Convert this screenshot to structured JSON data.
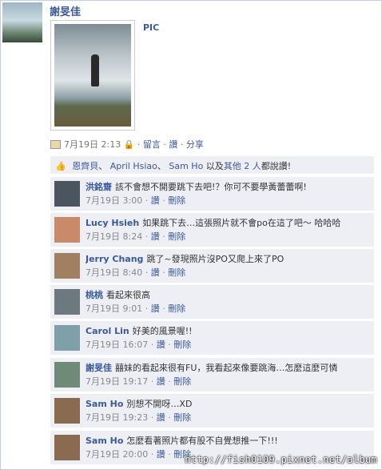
{
  "post": {
    "author": "謝旻佳",
    "photo_title": "PIC",
    "date": "7月19日 2:13",
    "privacy_icon": "lock-icon",
    "actions": [
      "留言",
      "讚",
      "分享"
    ],
    "separator": "·"
  },
  "likes": {
    "names": [
      "恩齊貝",
      "April Hsiao",
      "Sam Ho"
    ],
    "suffix_prefix": "以及",
    "others_link": "其他 2 人",
    "suffix": "都說讚!"
  },
  "comments": [
    {
      "name": "洪銘齋",
      "text": "該不會想不開要跳下去吧!？你可不要學黃蕾蕾啊!",
      "time": "7月19日 3:00",
      "like": "讚",
      "delete": "刪除",
      "avatar_color": "#4a5560"
    },
    {
      "name": "Lucy Hsieh",
      "text": "如果跳下去…這張照片就不會po在這了吧～ 哈哈哈",
      "time": "7月19日 8:24",
      "like": "讚",
      "delete": "刪除",
      "avatar_color": "#c98a6a"
    },
    {
      "name": "Jerry Chang",
      "text": "跳了~發現照片沒PO又爬上來了PO",
      "time": "7月19日 8:40",
      "like": "讚",
      "delete": "刪除",
      "avatar_color": "#a08060"
    },
    {
      "name": "桃桃",
      "text": "看起來很高",
      "time": "7月19日 9:01",
      "like": "讚",
      "delete": "刪除",
      "avatar_color": "#6c7a80"
    },
    {
      "name": "Carol Lin",
      "text": "好美的風景喔!!",
      "time": "7月19日 16:07",
      "like": "讚",
      "delete": "刪除",
      "avatar_color": "#7fa0a8"
    },
    {
      "name": "謝旻佳",
      "text": "囍妹的看起來很有FU，我看起來像要跳海…怎麼這麼可憐",
      "time": "7月19日 19:17",
      "like": "讚",
      "delete": "刪除",
      "avatar_color": "#6f8a77"
    },
    {
      "name": "Sam Ho",
      "text": "別想不開呀…XD",
      "time": "7月19日 19:23",
      "like": "讚",
      "delete": "刪除",
      "avatar_color": "#8a6a50"
    },
    {
      "name": "Sam Ho",
      "text": "怎麼看著照片都有股不自覺想推一下!!!",
      "time": "7月19日 20:00",
      "like": "讚",
      "delete": "刪除",
      "avatar_color": "#8a6a50"
    }
  ],
  "watermark": "http://fish0109.pixnet.net/album"
}
